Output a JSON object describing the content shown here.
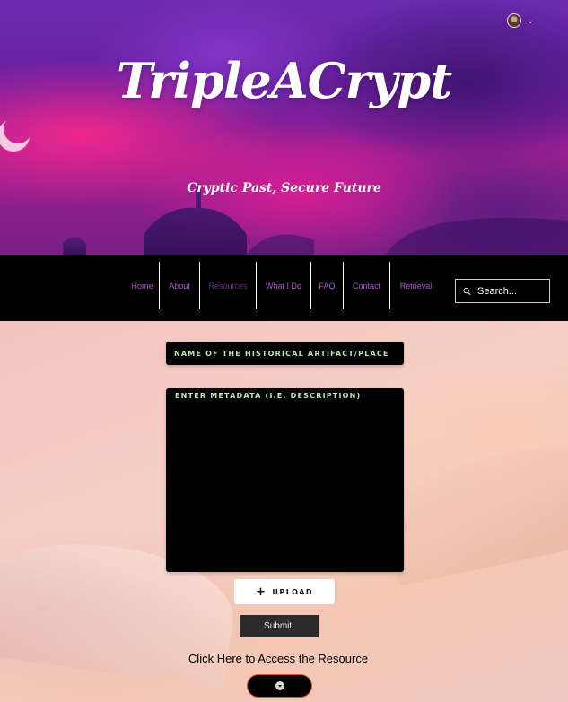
{
  "site": {
    "logo": "TripleACrypt",
    "tagline": "Cryptic Past, Secure Future"
  },
  "nav": {
    "items": [
      {
        "label": "Home"
      },
      {
        "label": "About"
      },
      {
        "label": "Resources"
      },
      {
        "label": "What I Do"
      },
      {
        "label": "FAQ"
      },
      {
        "label": "Contact"
      },
      {
        "label": "Retrieval"
      }
    ],
    "active_index": 2,
    "search_placeholder": "Search..."
  },
  "form": {
    "name_placeholder": "Name of the historical artifact/place",
    "metadata_placeholder": "Enter metadata (i.e. description)",
    "upload_label": "UPLOAD",
    "submit_label": "Submit!"
  },
  "resource": {
    "access_text": "Click Here to Access the Resource"
  },
  "icons": {
    "avatar": "user-avatar-icon",
    "account_menu": "chevron-down-icon",
    "search": "search-icon",
    "upload": "plus-icon",
    "download": "download-icon"
  },
  "colors": {
    "nav_link": "#b64fd6",
    "nav_link_active": "#6d2f85",
    "field_text": "#bde6b4",
    "download_border": "#e0502e"
  }
}
